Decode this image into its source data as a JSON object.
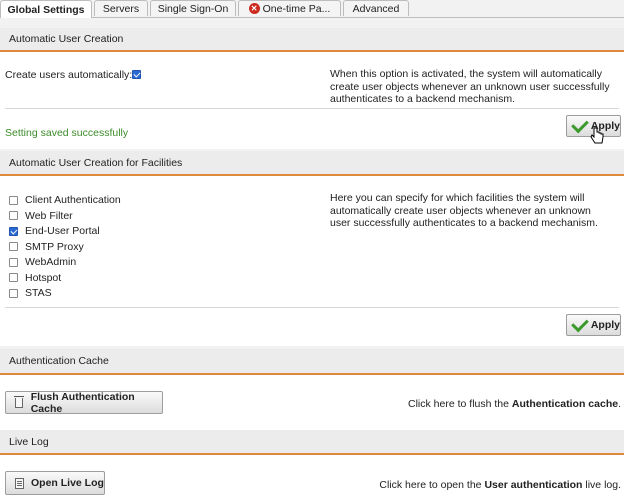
{
  "tabs": [
    {
      "label": "Global Settings",
      "active": true
    },
    {
      "label": "Servers"
    },
    {
      "label": "Single Sign-On"
    },
    {
      "label": "One-time Pa...",
      "icon": "error-x-icon"
    },
    {
      "label": "Advanced"
    }
  ],
  "auto_create": {
    "header": "Automatic User Creation",
    "checkbox_label": "Create users automatically:",
    "checked": true,
    "description": "When this option is activated, the system will automatically create user objects whenever an unknown user successfully authenticates to a backend mechanism.",
    "status": "Setting saved successfully",
    "status_color": "#3c8c2a",
    "apply_label": "Apply"
  },
  "facilities": {
    "header": "Automatic User Creation for Facilities",
    "description": "Here you can specify for which facilities the system will automatically create user objects whenever an unknown user successfully authenticates to a backend mechanism.",
    "items": [
      {
        "label": "Client Authentication",
        "checked": false
      },
      {
        "label": "Web Filter",
        "checked": false
      },
      {
        "label": "End-User Portal",
        "checked": true
      },
      {
        "label": "SMTP Proxy",
        "checked": false
      },
      {
        "label": "WebAdmin",
        "checked": false
      },
      {
        "label": "Hotspot",
        "checked": false
      },
      {
        "label": "STAS",
        "checked": false
      }
    ],
    "apply_label": "Apply"
  },
  "auth_cache": {
    "header": "Authentication Cache",
    "button_label": "Flush Authentication Cache",
    "hint_prefix": "Click here to flush the",
    "hint_bold": "Authentication cache",
    "hint_suffix": "."
  },
  "live_log": {
    "header": "Live Log",
    "button_label": "Open Live Log",
    "hint_prefix": "Click here to open the",
    "hint_bold": "User authentication",
    "hint_suffix": "live log."
  },
  "colors": {
    "accent_line": "#e0893a",
    "check_blue": "#2a6ad2",
    "apply_check": "#3c9a2c"
  }
}
